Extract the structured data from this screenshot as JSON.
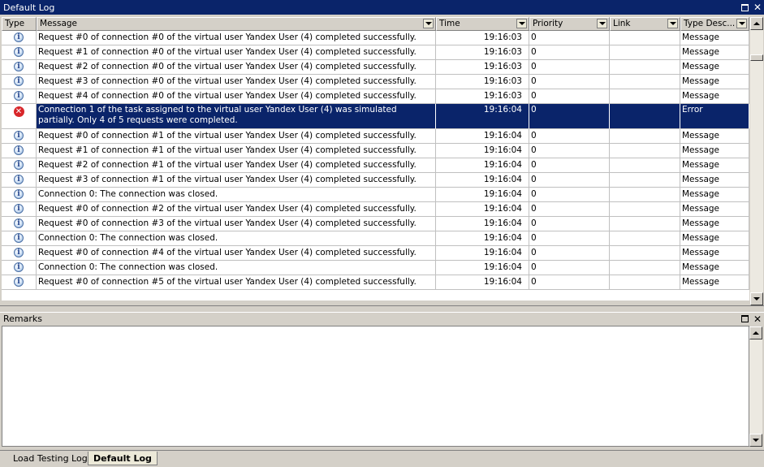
{
  "panel": {
    "title": "Default Log"
  },
  "columns": [
    {
      "label": "Type",
      "filter": false
    },
    {
      "label": "Message",
      "filter": true
    },
    {
      "label": "Time",
      "filter": true
    },
    {
      "label": "Priority",
      "filter": true
    },
    {
      "label": "Link",
      "filter": true
    },
    {
      "label": "Type Desc...",
      "filter": true
    }
  ],
  "rows": [
    {
      "type": "info",
      "message": "Request #0 of connection #0 of the virtual user Yandex User (4) completed successfully.",
      "time": "19:16:03",
      "priority": "0",
      "link": "",
      "type_desc": "Message"
    },
    {
      "type": "info",
      "message": "Request #1 of connection #0 of the virtual user Yandex User (4) completed successfully.",
      "time": "19:16:03",
      "priority": "0",
      "link": "",
      "type_desc": "Message"
    },
    {
      "type": "info",
      "message": "Request #2 of connection #0 of the virtual user Yandex User (4) completed successfully.",
      "time": "19:16:03",
      "priority": "0",
      "link": "",
      "type_desc": "Message"
    },
    {
      "type": "info",
      "message": "Request #3 of connection #0 of the virtual user Yandex User (4) completed successfully.",
      "time": "19:16:03",
      "priority": "0",
      "link": "",
      "type_desc": "Message"
    },
    {
      "type": "info",
      "message": "Request #4 of connection #0 of the virtual user Yandex User (4) completed successfully.",
      "time": "19:16:03",
      "priority": "0",
      "link": "",
      "type_desc": "Message"
    },
    {
      "type": "error",
      "selected": true,
      "message": "Connection 1 of the task assigned to the virtual user Yandex User (4) was simulated partially. Only 4 of 5 requests were completed.",
      "time": "19:16:04",
      "priority": "0",
      "link": "",
      "type_desc": "Error"
    },
    {
      "type": "info",
      "message": "Request #0 of connection #1 of the virtual user Yandex User (4) completed successfully.",
      "time": "19:16:04",
      "priority": "0",
      "link": "",
      "type_desc": "Message"
    },
    {
      "type": "info",
      "message": "Request #1 of connection #1 of the virtual user Yandex User (4) completed successfully.",
      "time": "19:16:04",
      "priority": "0",
      "link": "",
      "type_desc": "Message"
    },
    {
      "type": "info",
      "message": "Request #2 of connection #1 of the virtual user Yandex User (4) completed successfully.",
      "time": "19:16:04",
      "priority": "0",
      "link": "",
      "type_desc": "Message"
    },
    {
      "type": "info",
      "message": "Request #3 of connection #1 of the virtual user Yandex User (4) completed successfully.",
      "time": "19:16:04",
      "priority": "0",
      "link": "",
      "type_desc": "Message"
    },
    {
      "type": "info",
      "message": "Connection 0: The connection was closed.",
      "time": "19:16:04",
      "priority": "0",
      "link": "",
      "type_desc": "Message"
    },
    {
      "type": "info",
      "message": "Request #0 of connection #2 of the virtual user Yandex User (4) completed successfully.",
      "time": "19:16:04",
      "priority": "0",
      "link": "",
      "type_desc": "Message"
    },
    {
      "type": "info",
      "message": "Request #0 of connection #3 of the virtual user Yandex User (4) completed successfully.",
      "time": "19:16:04",
      "priority": "0",
      "link": "",
      "type_desc": "Message"
    },
    {
      "type": "info",
      "message": "Connection 0: The connection was closed.",
      "time": "19:16:04",
      "priority": "0",
      "link": "",
      "type_desc": "Message"
    },
    {
      "type": "info",
      "message": "Request #0 of connection #4 of the virtual user Yandex User (4) completed successfully.",
      "time": "19:16:04",
      "priority": "0",
      "link": "",
      "type_desc": "Message"
    },
    {
      "type": "info",
      "message": "Connection 0: The connection was closed.",
      "time": "19:16:04",
      "priority": "0",
      "link": "",
      "type_desc": "Message"
    },
    {
      "type": "info",
      "message": "Request #0 of connection #5 of the virtual user Yandex User (4) completed successfully.",
      "time": "19:16:04",
      "priority": "0",
      "link": "",
      "type_desc": "Message"
    }
  ],
  "remarks": {
    "title": "Remarks",
    "text": ""
  },
  "tabs": [
    {
      "label": "Load Testing Log",
      "active": false
    },
    {
      "label": "Default Log",
      "active": true
    }
  ],
  "colors": {
    "titlebar": "#0a246a",
    "selection": "#0a246a",
    "chrome": "#d4d0c8",
    "error": "#d8262a"
  }
}
